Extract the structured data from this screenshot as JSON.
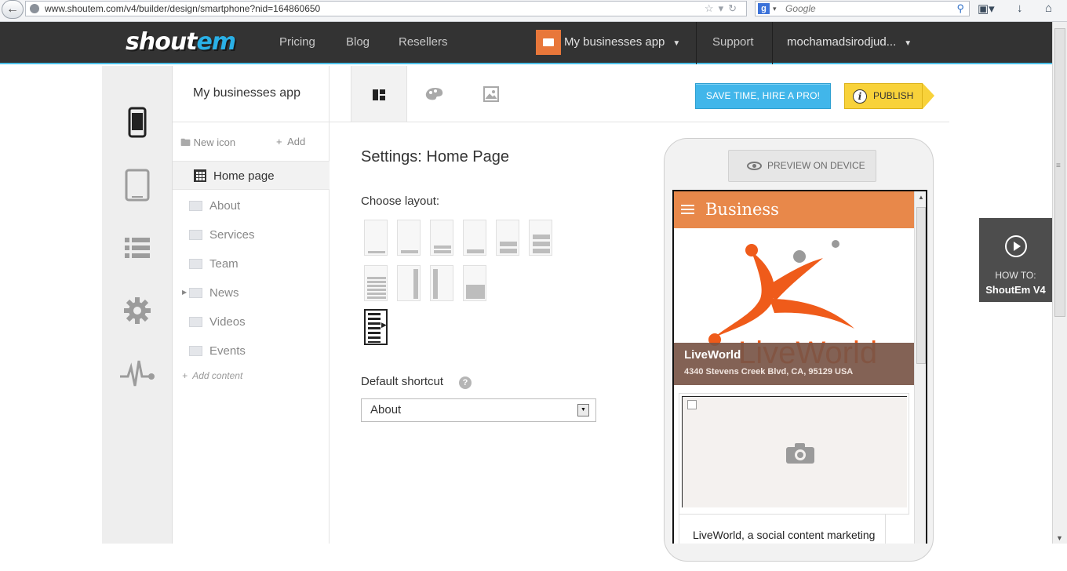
{
  "browser": {
    "url": "www.shoutem.com/v4/builder/design/smartphone?nid=164860650",
    "search_placeholder": "Google",
    "search_engine_icon": "g"
  },
  "topnav": {
    "logo_part1": "shout",
    "logo_part2": "em",
    "links": [
      "Pricing",
      "Blog",
      "Resellers"
    ],
    "app_switcher": "My businesses app",
    "support": "Support",
    "user": "mochamadsirodjud..."
  },
  "rail": {
    "items": [
      "smartphone-icon",
      "tablet-icon",
      "list-icon",
      "gear-icon",
      "analytics-icon"
    ],
    "accent": "#333333"
  },
  "sidebar": {
    "app_name": "My businesses app",
    "new_icon": "New icon",
    "add": "Add",
    "home_page": "Home page",
    "items": [
      {
        "label": "About",
        "icon": "about-icon"
      },
      {
        "label": "Services",
        "icon": "services-icon"
      },
      {
        "label": "Team",
        "icon": "team-icon"
      },
      {
        "label": "News",
        "icon": "news-icon",
        "expandable": true
      },
      {
        "label": "Videos",
        "icon": "videos-icon"
      },
      {
        "label": "Events",
        "icon": "events-icon"
      }
    ],
    "add_content": "Add content"
  },
  "toolbar": {
    "hire_pro": "SAVE TIME, HIRE A PRO!",
    "publish": "PUBLISH",
    "publish_info": "i",
    "colors": {
      "hire": "#41b6ea",
      "publish": "#f8d23a"
    }
  },
  "settings": {
    "title": "Settings: Home Page",
    "choose_layout": "Choose layout:",
    "default_shortcut": "Default shortcut",
    "help": "?",
    "selected_shortcut": "About"
  },
  "preview": {
    "button": "PREVIEW ON DEVICE",
    "app_header": "Business",
    "header_color": "#e8884a",
    "logo_text": "LiveWorld",
    "business_name": "LiveWorld",
    "address": "4340 Stevens Creek Blvd, CA, 95129 USA",
    "description": "LiveWorld, a social content marketing"
  },
  "howto": {
    "line1": "HOW TO:",
    "line2": "ShoutEm V4"
  }
}
